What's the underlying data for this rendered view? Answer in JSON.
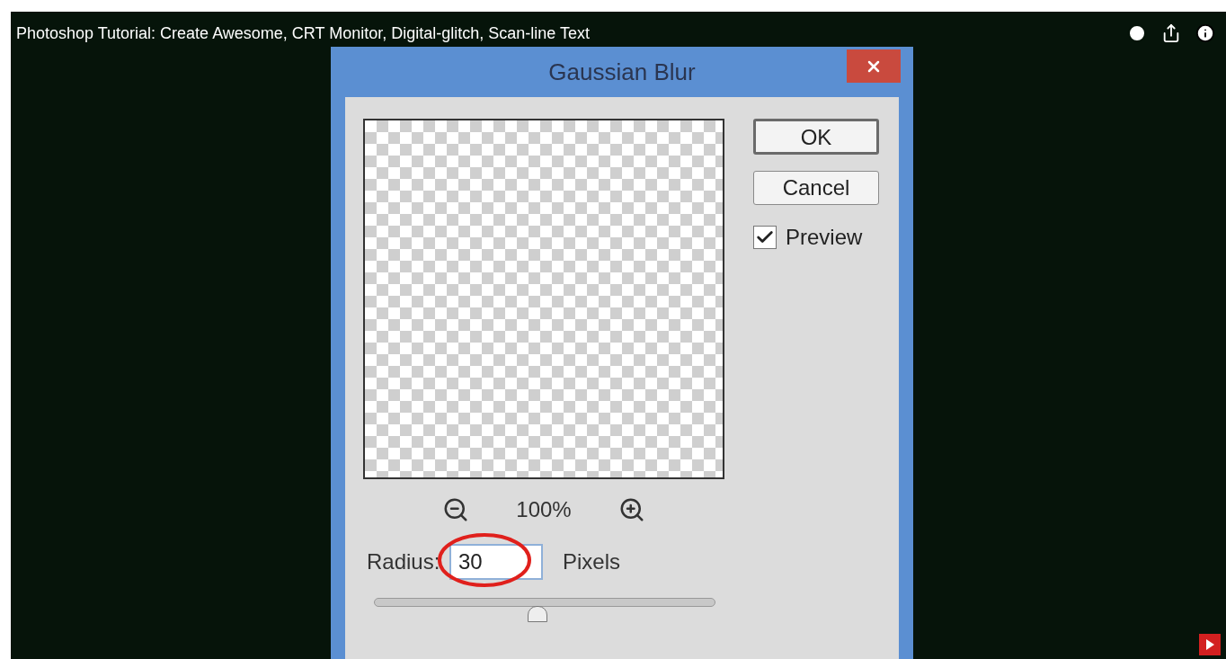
{
  "video": {
    "title": "Photoshop Tutorial: Create Awesome, CRT Monitor, Digital-glitch, Scan-line Text"
  },
  "dialog": {
    "title": "Gaussian Blur",
    "buttons": [
      {
        "label": "OK",
        "default": true
      },
      {
        "label": "Cancel",
        "default": false
      }
    ],
    "preview_checkbox": {
      "label": "Preview",
      "checked": true
    },
    "zoom": "100%",
    "radius": {
      "label": "Radius:",
      "value": "30",
      "unit": "Pixels"
    },
    "slider": {
      "level": 0.48
    }
  }
}
